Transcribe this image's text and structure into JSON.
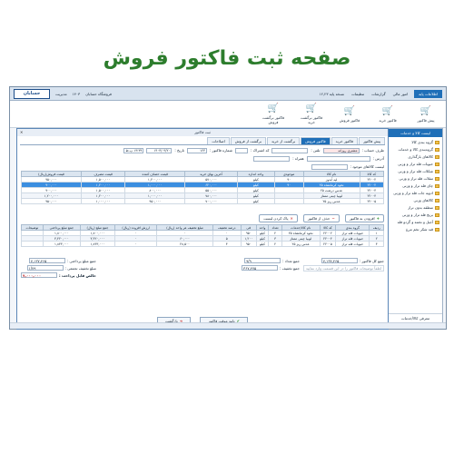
{
  "headline": "صفحه ثبت فاکتور فروش",
  "topbar": {
    "tab_main": "اطلاعات پایه",
    "menus": [
      "امور مالی",
      "گزارشات",
      "تنظیمات"
    ],
    "store": "فروشگاه حسابان",
    "year": "۱۴۰۳",
    "version": "نسخه پایه ۱۲,۲۳",
    "user": "مدیریت",
    "logo": "حسابان"
  },
  "ribbon": [
    {
      "label": "پیش فاکتور",
      "icon": "🛒"
    },
    {
      "label": "فاکتور خرید",
      "icon": "🛒"
    },
    {
      "label": "فاکتور فروش",
      "icon": "🛒"
    },
    {
      "label": "فاکتور برگشت خرید",
      "icon": "🛒"
    },
    {
      "label": "فاکتور برگشت فروش",
      "icon": "🛒"
    }
  ],
  "dialog": {
    "title": "ثبت فاکتور"
  },
  "sidebar": {
    "header": "لیست کالا و خدمات",
    "root": "گروه بندی کالا",
    "items": [
      "گروه‌بندی کالا و خدمات",
      "کالاهای بارگذاری",
      "حبوبات فله تراز و وزنی",
      "شکلات فله تراز و وزنی",
      "تنقلات فله تراز و وزنی",
      "چای فله تراز و وزنی",
      "ادویه جات فله تراز و وزنی",
      "کالاهای وزنی",
      "منطقه بدون تراز",
      "برنج فله تراز و وزنی",
      "آجیل و تخمه و گردو فله",
      "قند شکر تخم مرغ"
    ],
    "footer": "معرفی کالا/خدمات"
  },
  "tabs": [
    "پیش فاکتور",
    "فاکتور خرید",
    "فاکتور فروش",
    "برگشت از خرید",
    "برگشت از فروش",
    "اصلاحات"
  ],
  "form": {
    "account_label": "طرف حساب :",
    "account_value": "مشتری روزانه",
    "phone_label": "تلفن :",
    "companion_label": "همراه :",
    "address_label": "آدرس :",
    "subscription_label": "کد اشتراک :",
    "invoice_label": "شماره فاکتور :",
    "invoice_value": "۱۲۳",
    "date_label": "تاریخ :",
    "date_value": "۱۴۰۳/۰۳/۲۰",
    "time_value": "۱۳:۳۹ پ.ظ"
  },
  "products": {
    "search_label": "لیست کالاهای موجود :",
    "headers": [
      "کد کالا",
      "نام کالا",
      "موجودی",
      "واحد اندازه",
      "آخرین بهای خرید",
      "قیمت حصاف کننده",
      "قیمت مصرف",
      "قیمت فروش(ریال)"
    ],
    "rows": [
      [
        "۲۲۰۰۲",
        "لپه آبدوز",
        "۹۰",
        "کیلو",
        "۵۷۰,۰۰۰",
        "۱,۲۰۰,۰۰۰",
        "۱,۵۰۰,۰۰۰",
        "۹۵۰,۰۰۰"
      ],
      [
        "۲۲۰۰۲",
        "نخود کرمانشاه ۲۵",
        "۹۰",
        "کیلو",
        "۶۲۰,۰۰۰",
        "۱,۰۰۰,۰۰۰",
        "۱,۲۰۰,۰۰۰",
        "۹۰۰,۰۰۰"
      ],
      [
        "۲۲۰۰۴",
        "عدس درشت ۲۵",
        "",
        "کیلو",
        "۵۵۰,۰۰۰",
        "۸۰۰,۰۰۰",
        "۱,۵۰۰,۰۰۰",
        "۹۰۰,۰۰۰"
      ],
      [
        "۲۲۰۰۴",
        "لوبیا چیتی ممتاز",
        "",
        "کیلو",
        "۷۸۰,۰۰۰",
        "۱,۰۰۰,۰۰۰",
        "۱,۲۰۰,۰۰۰",
        "۱,۲۰۰,۰۰۰"
      ],
      [
        "۲۲۰۰۵",
        "عدس ریز ۲۵",
        "",
        "کیلو",
        "۷۰۰,۰۰۰",
        "۹۵۰,۰۰۰",
        "۱,۰۰۰,۰۰۰",
        "۹۵۰,۰۰۰"
      ]
    ]
  },
  "actions": {
    "add": "افزودن به فاکتور",
    "remove": "حذف از فاکتور",
    "clear": "پاک کردن لیست"
  },
  "invoice": {
    "headers": [
      "ردیف",
      "گروه بندی",
      "کد کالا",
      "نام کالا/خدمات",
      "تعداد",
      "واحد",
      "فی",
      "درصد تخفیف",
      "مبلغ تخفیف هر واحد (ریال)",
      "ارزش افزوده (ریال)",
      "جمع مبلغ (ریال)",
      "جمع مبلغ پرداختی",
      "توضیحات"
    ],
    "rows": [
      [
        "۱",
        "حبوبات فله تراز",
        "۲۲۰۰۲",
        "نخود کرمانشاه ۲۵",
        "۲",
        "کیلو",
        "۹۵۰",
        "۰",
        "۰",
        "۰",
        "۱,۸۰۰,۰۰۰",
        "۱,۸۰۰,۰۰۰",
        ""
      ],
      [
        "۲",
        "حبوبات فله تراز",
        "۲۲۰۰۴",
        "لوبیا چیتی ممتاز",
        "۳",
        "کیلو",
        "۱,۲۰۰",
        "۵",
        "۶۰,۰۰۰",
        "۰",
        "۳,۴۲۰,۰۰۰",
        "۳,۴۲۰,۰۰۰",
        ""
      ],
      [
        "۳",
        "حبوبات فله تراز",
        "۲۲۰۰۵",
        "عدس ریز ۲۵",
        "۲",
        "کیلو",
        "۹۵۰",
        "۳",
        "۲۸,۵۰۰",
        "۰",
        "۱,۸۴۳,۰۰۰",
        "۱,۸۴۳,۰۰۰",
        ""
      ]
    ]
  },
  "totals": {
    "sum_label": "جمع کل فاکتور :",
    "sum_value": "۷,۱۳۷,۴۶۵",
    "count_label": "جمع تعداد :",
    "count_value": "۹/۹",
    "discount_label": "جمع تخفیف :",
    "discount_value": "۳۶۷,۴۷۵",
    "payable_label": "جمع مبلغ پرداختی :",
    "payable_value": "۷,۱۳۷,۴۶۵",
    "extra_label": "مبلغ تخفیف تجمعی :",
    "extra_value": "۱/۷۹",
    "final_label": "خالص قابل پرداخت :",
    "final_value": "۷,۰۰۰,۰۰۰",
    "note": "لطفاً توضیحات فاکتور را در این قسمت وارد نمایید"
  },
  "footer": {
    "confirm": "تایید موقت فاکتور",
    "back": "بازگشت"
  }
}
